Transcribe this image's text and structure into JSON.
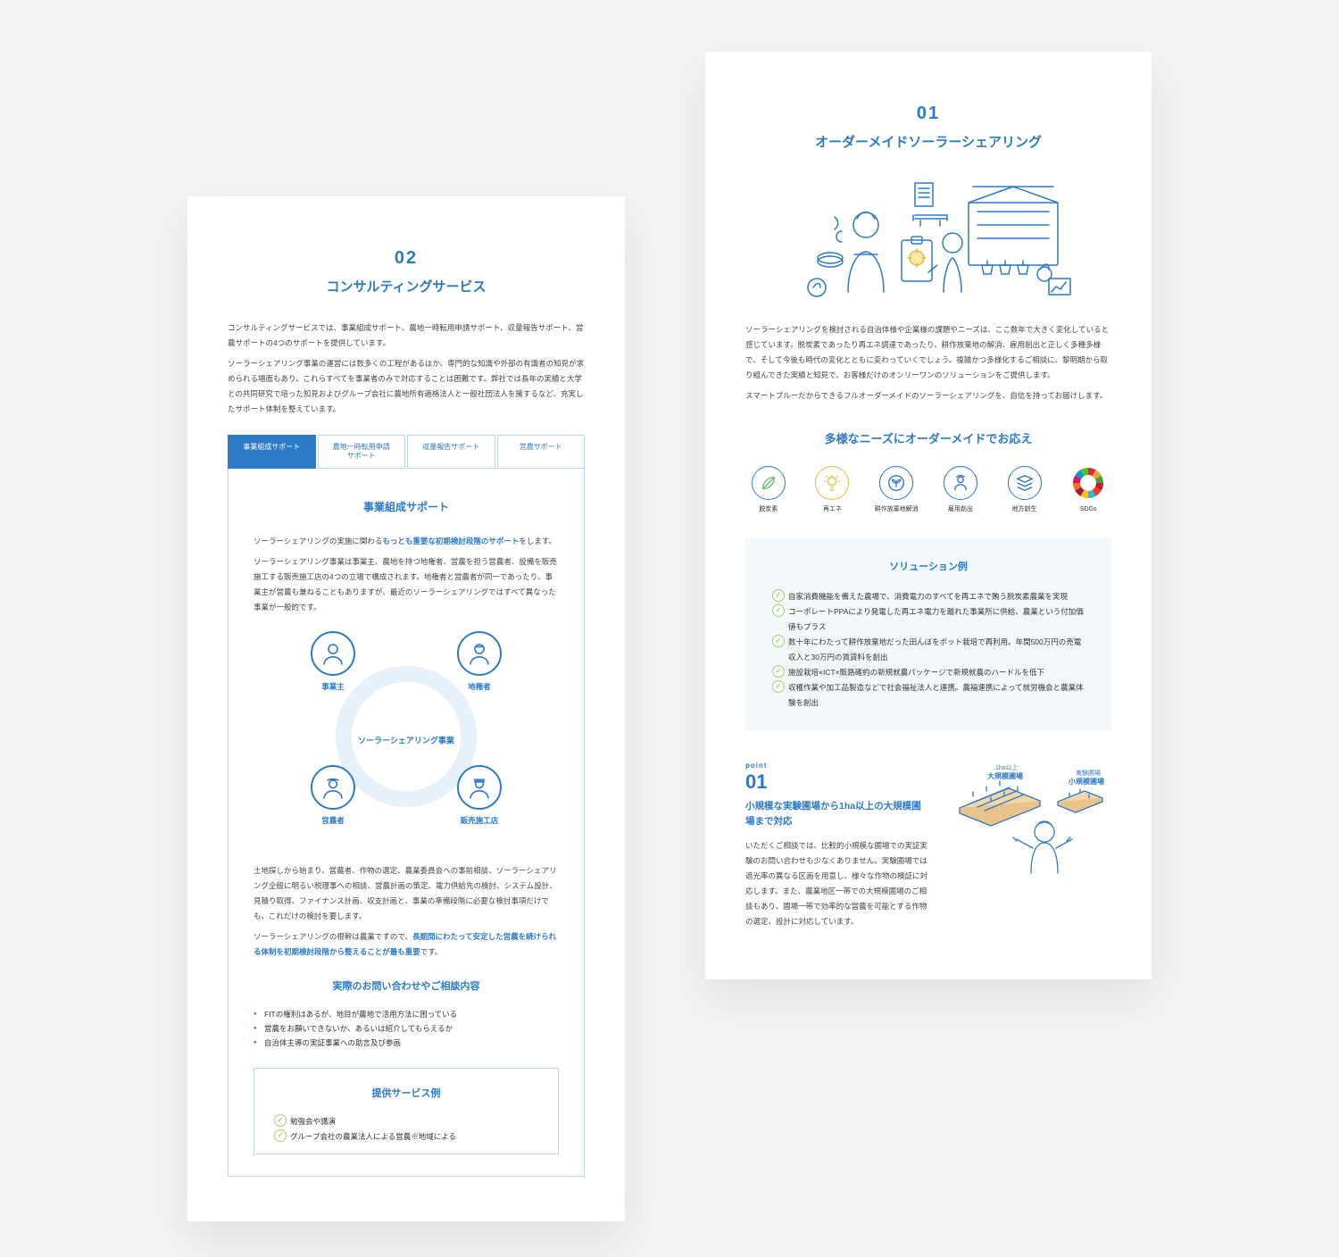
{
  "left": {
    "number": "02",
    "title": "コンサルティングサービス",
    "intro1": "コンサルティングサービスでは、事業組成サポート、農地一時転用申請サポート、収量報告サポート、営農サポートの4つのサポートを提供しています。",
    "intro2": "ソーラーシェアリング事業の運営には数多くの工程があるほか、専門的な知識や外部の有識者の知見が求められる場面もあり、これらすべてを事業者のみで対応することは困難です。弊社では長年の実績と大学との共同研究で培った知見およびグループ会社に農地所有適格法人と一般社団法人を擁するなど、充実したサポート体制を整えています。",
    "tabs": [
      "事業組成サポート",
      "農地一時転用申請\nサポート",
      "収量報告サポート",
      "営農サポート"
    ],
    "panel": {
      "title": "事業組成サポート",
      "line1_a": "ソーラーシェアリングの実施に関わる",
      "line1_b": "もっとも重要な初期検討段階のサポート",
      "line1_c": "をします。",
      "para1": "ソーラーシェアリング事業は事業主、農地を持つ地権者、営農を担う営農者、設備を販売施工する販売施工店の4つの立場で構成されます。地権者と営農者が同一であったり、事業主が営農も兼ねることもありますが、最近のソーラーシェアリングではすべて異なった事業が一般的です。",
      "diagram_center": "ソーラーシェアリング事業",
      "nodes": {
        "tl": "事業主",
        "tr": "地権者",
        "bl": "営農者",
        "br": "販売施工店"
      },
      "para2": "土地探しから始まり、営農者、作物の選定、農業委員会への事前相談、ソーラーシェアリング全般に明るい税理事への相談、営農計画の策定、電力供給先の検討、システム設計、見積り取得、ファイナンス計画、収支計画と、事業の準備段階に必要な検討事項だけでも、これだけの検討を要します。",
      "para3_a": "ソーラーシェアリングの根幹は農業ですので、",
      "para3_b": "長期間にわたって安定した営農を続けられる体制を初期検討段階から整えることが最も重要",
      "para3_c": "です。",
      "inq_title": "実際のお問い合わせやご相談内容",
      "inq_items": [
        "FITの権利はあるが、地目が農地で活用方法に困っている",
        "営農をお願いできないか、あるいは紹介してもらえるか",
        "自治体主導の実証事業への助言及び参画"
      ],
      "svc_title": "提供サービス例",
      "svc_items": [
        "勉強会や講演",
        "グループ会社の農業法人による営農※地域による"
      ]
    }
  },
  "right": {
    "number": "01",
    "title": "オーダーメイドソーラーシェアリング",
    "intro1": "ソーラーシェアリングを検討される自治体様や企業様の課題やニーズは、ここ数年で大きく変化していると感じています。脱炭素であったり再エネ調達であったり、耕作放棄地の解消、雇用創出と正しく多種多様で、そして今後も時代の変化とともに変わっていくでしょう。複雑かつ多様化するご相談に、黎明期から取り組んできた実績と知見で、お客様だけのオンリーワンのソリューションをご提供します。",
    "intro2": "スマートブルーだからできるフルオーダーメイドのソーラーシェアリングを、自信を持ってお届けします。",
    "needs_title": "多様なニーズにオーダーメイドでお応え",
    "needs": [
      {
        "label": "脱炭素"
      },
      {
        "label": "再エネ"
      },
      {
        "label": "耕作放棄地解消"
      },
      {
        "label": "雇用創出"
      },
      {
        "label": "地方創生"
      },
      {
        "label": "SDGs"
      }
    ],
    "sol_title": "ソリューション例",
    "sol_items": [
      "自家消費機能を備えた農場で、消費電力のすべてを再エネで賄う脱炭素農業を実現",
      "コーポレートPPAにより発電した再エネ電力を離れた事業所に供給、農業という付加価値もプラス",
      "数十年にわたって耕作放棄地だった田んぼをポット栽培で再利用。年間500万円の売電収入と30万円の賃貸料を創出",
      "施設栽培×ICT×販路確約の新規就農パッケージで新規就農のハードルを低下",
      "収穫作業や加工品製造などで社会福祉法人と連携。農福連携によって就労機会と農業体験を創出"
    ],
    "point": {
      "tag": "point",
      "num": "01",
      "title": "小規模な実験圃場から1ha以上の大規模圃場まで対応",
      "body": "いただくご相談では、比較的小規模な圃場での実証実験のお問い合わせも少なくありません。実験圃場では遮光率の異なる区画を用意し、様々な作物の検証に対応します。また、農業地区一帯での大規模圃場のご相談もあり、圃場一帯で効率的な営農を可能とする作物の選定、設計に対応しています。",
      "img_label1": "1ha以上",
      "img_label1b": "大規模圃場",
      "img_label2": "実験圃場",
      "img_label2b": "小規模圃場"
    }
  }
}
